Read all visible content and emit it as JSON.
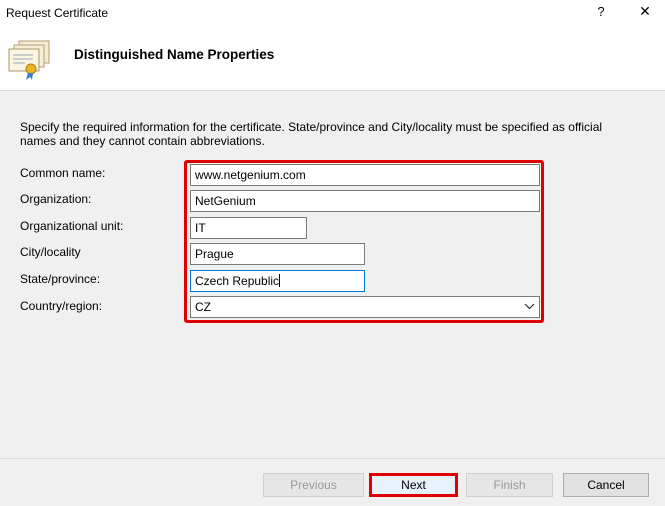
{
  "window": {
    "title": "Request Certificate",
    "help_label": "?",
    "close_label": "✕"
  },
  "header": {
    "title": "Distinguished Name Properties",
    "icon": "certificate-icon"
  },
  "description": "Specify the required information for the certificate. State/province and City/locality must be specified as official names and they cannot contain abbreviations.",
  "form": {
    "common_name": {
      "label": "Common name:",
      "value": "www.netgenium.com"
    },
    "organization": {
      "label": "Organization:",
      "value": "NetGenium"
    },
    "organizational_unit": {
      "label": "Organizational unit:",
      "value": "IT"
    },
    "city": {
      "label": "City/locality",
      "value": "Prague"
    },
    "state": {
      "label": "State/province:",
      "value": "Czech Republic"
    },
    "country": {
      "label": "Country/region:",
      "value": "CZ"
    }
  },
  "buttons": {
    "previous": "Previous",
    "next": "Next",
    "finish": "Finish",
    "cancel": "Cancel"
  },
  "colors": {
    "highlight": "#e00000",
    "focus_border": "#0078d7"
  }
}
